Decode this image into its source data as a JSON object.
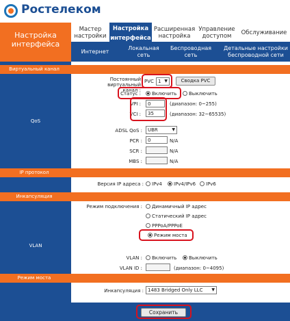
{
  "brand": {
    "logo_text": "Ростелеком"
  },
  "left_title": {
    "line1": "Настройка",
    "line2": "интерфейса"
  },
  "tabs": [
    {
      "l1": "Мастер",
      "l2": "настройки"
    },
    {
      "l1": "Настройка",
      "l2": "интерфейса"
    },
    {
      "l1": "Расширенная",
      "l2": "настройка"
    },
    {
      "l1": "Управление",
      "l2": "доступом"
    },
    {
      "l1": "Обслуживание",
      "l2": ""
    }
  ],
  "subtabs": [
    {
      "l1": "Интернет",
      "l2": ""
    },
    {
      "l1": "Локальная",
      "l2": "сеть"
    },
    {
      "l1": "Беспроводная",
      "l2": "сеть"
    },
    {
      "l1": "Детальные настройки",
      "l2": "беспроводной сети"
    }
  ],
  "sections": {
    "virtual_channel": "Виртуальный канал",
    "qos": "QoS",
    "ip_protocol": "IP протокол",
    "encapsulation": "Инкапсуляция",
    "vlan": "VLAN",
    "bridge_mode": "Режим моста"
  },
  "pvc": {
    "label_l1": "Постоянный виртуальный",
    "label_l2": "канал :",
    "prefix": "PVC",
    "value": "1",
    "summary_button": "Сводка PVC"
  },
  "status": {
    "label": "Статус :",
    "enable": "Включить",
    "disable": "Выключить",
    "selected": "enable"
  },
  "vpi": {
    "label": "VPI :",
    "value": "0",
    "range": "(диапазон: 0~255)"
  },
  "vci": {
    "label": "VCI :",
    "value": "35",
    "range": "(диапазон: 32~65535)"
  },
  "qos": {
    "adsl_label": "ADSL QoS :",
    "adsl_value": "UBR",
    "pcr_label": "PCR :",
    "pcr_value": "0",
    "pcr_na": "N/A",
    "scr_label": "SCR :",
    "scr_value": "",
    "scr_na": "N/A",
    "mbs_label": "MBS :",
    "mbs_value": "",
    "mbs_na": "N/A"
  },
  "ip": {
    "label": "Версия IP адреса :",
    "opt1": "IPv4",
    "opt2": "IPv4/IPv6",
    "opt3": "IPv6",
    "selected": "IPv4/IPv6"
  },
  "encap": {
    "label": "Режим подключения :",
    "opt1": "Динамичный IP адрес",
    "opt2": "Статический IP адрес",
    "opt3": "PPPoA/PPPoE",
    "opt4": "Режим моста",
    "selected": "opt4"
  },
  "vlan": {
    "label": "VLAN :",
    "enable": "Включить",
    "disable": "Выключить",
    "selected": "disable",
    "id_label": "VLAN ID :",
    "id_value": "",
    "id_range": "(диапазон: 0~4095)"
  },
  "bridge": {
    "label": "Инкапсуляция :",
    "value": "1483 Bridged Only LLC"
  },
  "save_button": "Сохранить",
  "colors": {
    "orange": "#f26f21",
    "blue": "#1c4f94",
    "highlight": "#d8121d"
  }
}
